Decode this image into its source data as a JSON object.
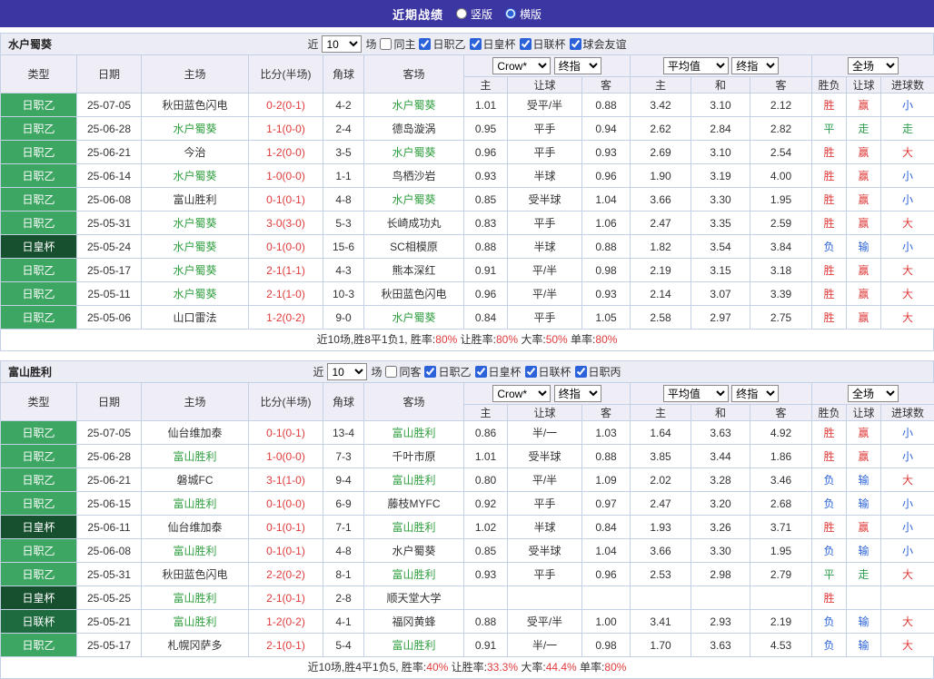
{
  "topbar": {
    "title": "近期战绩",
    "layout_options": [
      {
        "label": "竖版",
        "selected": false
      },
      {
        "label": "横版",
        "selected": true
      }
    ]
  },
  "labels": {
    "near": "近",
    "matches": "场",
    "col_type": "类型",
    "col_date": "日期",
    "col_home": "主场",
    "col_score": "比分(半场)",
    "col_corner": "角球",
    "col_away": "客场",
    "col_home_odds": "主",
    "col_handicap": "让球",
    "col_away_odds": "客",
    "col_avg_home": "主",
    "col_avg_draw": "和",
    "col_avg_away": "客",
    "col_result": "胜负",
    "col_let": "让球",
    "col_goals": "进球数"
  },
  "selects": {
    "count": "10",
    "odds_source": "Crow*",
    "odds_time": "终指",
    "avg": "平均值",
    "avg_time": "终指",
    "scope": "全场"
  },
  "league_colors": {
    "日职乙": "#3ea663",
    "日皇杯": "#17502f",
    "日联杯": "#1f6b40"
  },
  "result_colors": {
    "win": "#e03b3b",
    "draw": "#2e9e4f",
    "loss": "#2b62d9"
  },
  "tables": [
    {
      "team": "水户蜀葵",
      "checkboxes": [
        {
          "label": "同主",
          "checked": false
        },
        {
          "label": "日职乙",
          "checked": true
        },
        {
          "label": "日皇杯",
          "checked": true
        },
        {
          "label": "日联杯",
          "checked": true
        },
        {
          "label": "球会友谊",
          "checked": true
        }
      ],
      "rows": [
        [
          "日职乙",
          "25-07-05",
          "秋田蓝色闪电",
          "0-2(0-1)",
          "4-2",
          "水户蜀葵",
          "1.01",
          "受平/半",
          "0.88",
          "3.42",
          "3.10",
          "2.12",
          "胜",
          "赢",
          "小"
        ],
        [
          "日职乙",
          "25-06-28",
          "水户蜀葵",
          "1-1(0-0)",
          "2-4",
          "德岛漩涡",
          "0.95",
          "平手",
          "0.94",
          "2.62",
          "2.84",
          "2.82",
          "平",
          "走",
          "走"
        ],
        [
          "日职乙",
          "25-06-21",
          "今治",
          "1-2(0-0)",
          "3-5",
          "水户蜀葵",
          "0.96",
          "平手",
          "0.93",
          "2.69",
          "3.10",
          "2.54",
          "胜",
          "赢",
          "大"
        ],
        [
          "日职乙",
          "25-06-14",
          "水户蜀葵",
          "1-0(0-0)",
          "1-1",
          "鸟栖沙岩",
          "0.93",
          "半球",
          "0.96",
          "1.90",
          "3.19",
          "4.00",
          "胜",
          "赢",
          "小"
        ],
        [
          "日职乙",
          "25-06-08",
          "富山胜利",
          "0-1(0-1)",
          "4-8",
          "水户蜀葵",
          "0.85",
          "受半球",
          "1.04",
          "3.66",
          "3.30",
          "1.95",
          "胜",
          "赢",
          "小"
        ],
        [
          "日职乙",
          "25-05-31",
          "水户蜀葵",
          "3-0(3-0)",
          "5-3",
          "长崎成功丸",
          "0.83",
          "平手",
          "1.06",
          "2.47",
          "3.35",
          "2.59",
          "胜",
          "赢",
          "大"
        ],
        [
          "日皇杯",
          "25-05-24",
          "水户蜀葵",
          "0-1(0-0)",
          "15-6",
          "SC相模原",
          "0.88",
          "半球",
          "0.88",
          "1.82",
          "3.54",
          "3.84",
          "负",
          "输",
          "小"
        ],
        [
          "日职乙",
          "25-05-17",
          "水户蜀葵",
          "2-1(1-1)",
          "4-3",
          "熊本深红",
          "0.91",
          "平/半",
          "0.98",
          "2.19",
          "3.15",
          "3.18",
          "胜",
          "赢",
          "大"
        ],
        [
          "日职乙",
          "25-05-11",
          "水户蜀葵",
          "2-1(1-0)",
          "10-3",
          "秋田蓝色闪电",
          "0.96",
          "平/半",
          "0.93",
          "2.14",
          "3.07",
          "3.39",
          "胜",
          "赢",
          "大"
        ],
        [
          "日职乙",
          "25-05-06",
          "山口雷法",
          "1-2(0-2)",
          "9-0",
          "水户蜀葵",
          "0.84",
          "平手",
          "1.05",
          "2.58",
          "2.97",
          "2.75",
          "胜",
          "赢",
          "大"
        ]
      ],
      "footer": [
        {
          "text": "近10场,胜8平1负1, 胜率:",
          "red": false
        },
        {
          "text": "80%",
          "red": true
        },
        {
          "text": " 让胜率:",
          "red": false
        },
        {
          "text": "80%",
          "red": true
        },
        {
          "text": " 大率:",
          "red": false
        },
        {
          "text": "50%",
          "red": true
        },
        {
          "text": " 单率:",
          "red": false
        },
        {
          "text": "80%",
          "red": true
        }
      ]
    },
    {
      "team": "富山胜利",
      "checkboxes": [
        {
          "label": "同客",
          "checked": false
        },
        {
          "label": "日职乙",
          "checked": true
        },
        {
          "label": "日皇杯",
          "checked": true
        },
        {
          "label": "日联杯",
          "checked": true
        },
        {
          "label": "日职丙",
          "checked": true
        }
      ],
      "rows": [
        [
          "日职乙",
          "25-07-05",
          "仙台维加泰",
          "0-1(0-1)",
          "13-4",
          "富山胜利",
          "0.86",
          "半/一",
          "1.03",
          "1.64",
          "3.63",
          "4.92",
          "胜",
          "赢",
          "小"
        ],
        [
          "日职乙",
          "25-06-28",
          "富山胜利",
          "1-0(0-0)",
          "7-3",
          "千叶市原",
          "1.01",
          "受半球",
          "0.88",
          "3.85",
          "3.44",
          "1.86",
          "胜",
          "赢",
          "小"
        ],
        [
          "日职乙",
          "25-06-21",
          "磐城FC",
          "3-1(1-0)",
          "9-4",
          "富山胜利",
          "0.80",
          "平/半",
          "1.09",
          "2.02",
          "3.28",
          "3.46",
          "负",
          "输",
          "大"
        ],
        [
          "日职乙",
          "25-06-15",
          "富山胜利",
          "0-1(0-0)",
          "6-9",
          "藤枝MYFC",
          "0.92",
          "平手",
          "0.97",
          "2.47",
          "3.20",
          "2.68",
          "负",
          "输",
          "小"
        ],
        [
          "日皇杯",
          "25-06-11",
          "仙台维加泰",
          "0-1(0-1)",
          "7-1",
          "富山胜利",
          "1.02",
          "半球",
          "0.84",
          "1.93",
          "3.26",
          "3.71",
          "胜",
          "赢",
          "小"
        ],
        [
          "日职乙",
          "25-06-08",
          "富山胜利",
          "0-1(0-1)",
          "4-8",
          "水户蜀葵",
          "0.85",
          "受半球",
          "1.04",
          "3.66",
          "3.30",
          "1.95",
          "负",
          "输",
          "小"
        ],
        [
          "日职乙",
          "25-05-31",
          "秋田蓝色闪电",
          "2-2(0-2)",
          "8-1",
          "富山胜利",
          "0.93",
          "平手",
          "0.96",
          "2.53",
          "2.98",
          "2.79",
          "平",
          "走",
          "大"
        ],
        [
          "日皇杯",
          "25-05-25",
          "富山胜利",
          "2-1(0-1)",
          "2-8",
          "顺天堂大学",
          "",
          "",
          "",
          "",
          "",
          "",
          "胜",
          "",
          ""
        ],
        [
          "日联杯",
          "25-05-21",
          "富山胜利",
          "1-2(0-2)",
          "4-1",
          "福冈黄蜂",
          "0.88",
          "受平/半",
          "1.00",
          "3.41",
          "2.93",
          "2.19",
          "负",
          "输",
          "大"
        ],
        [
          "日职乙",
          "25-05-17",
          "札幌冈萨多",
          "2-1(0-1)",
          "5-4",
          "富山胜利",
          "0.91",
          "半/一",
          "0.98",
          "1.70",
          "3.63",
          "4.53",
          "负",
          "输",
          "大"
        ]
      ],
      "footer": [
        {
          "text": "近10场,胜4平1负5, 胜率:",
          "red": false
        },
        {
          "text": "40%",
          "red": true
        },
        {
          "text": " 让胜率:",
          "red": false
        },
        {
          "text": "33.3%",
          "red": true
        },
        {
          "text": " 大率:",
          "red": false
        },
        {
          "text": "44.4%",
          "red": true
        },
        {
          "text": " 单率:",
          "red": false
        },
        {
          "text": "80%",
          "red": true
        }
      ]
    }
  ]
}
